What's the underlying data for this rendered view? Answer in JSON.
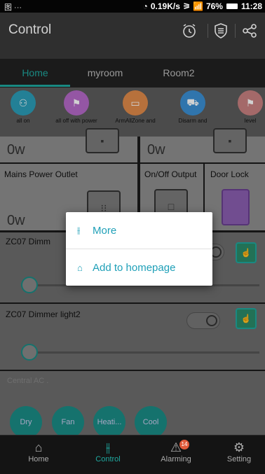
{
  "status": {
    "left": "图 ···",
    "speed": "0.19K/s",
    "signal": "⚞ 📶",
    "battery": "76%",
    "time": "11:28"
  },
  "toolbar": {
    "title": "Control",
    "icons": [
      "alarm-clock-icon",
      "shield-icon",
      "share-icon"
    ]
  },
  "tabs": [
    "Home",
    "myroom",
    "Room2"
  ],
  "scenes": [
    {
      "label": "all on",
      "color": "#2b9db7"
    },
    {
      "label": "all off with power",
      "color": "#b569c8"
    },
    {
      "label": "ArmAllZone and",
      "color": "#e08a4a"
    },
    {
      "label": "Disarm and",
      "color": "#3b8fd4"
    },
    {
      "label": "level",
      "color": "#c98080"
    }
  ],
  "cards": {
    "top_left_value": "0w",
    "top_right_value": "0w",
    "mains_name": "Mains Power Outlet",
    "mains_value": "0w",
    "onoff_name": "On/Off Output",
    "door_name": "Door Lock"
  },
  "dimmers": [
    {
      "name": "ZC07 Dimm"
    },
    {
      "name": "ZC07 Dimmer light2"
    }
  ],
  "ac": {
    "name": "Central AC .",
    "modes": [
      "Dry",
      "Fan",
      "Heati...",
      "Cool"
    ]
  },
  "popup": {
    "more": "More",
    "add_home": "Add to homepage"
  },
  "nav": [
    {
      "label": "Home",
      "active": false
    },
    {
      "label": "Control",
      "active": true
    },
    {
      "label": "Alarming",
      "active": false,
      "badge": "14"
    },
    {
      "label": "Setting",
      "active": false
    }
  ]
}
